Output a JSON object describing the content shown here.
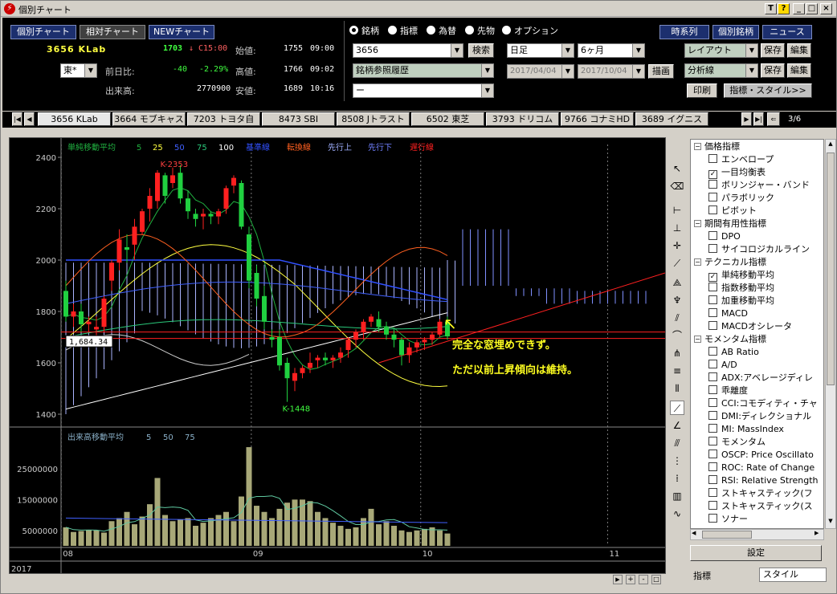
{
  "window": {
    "title": "個別チャート",
    "buttons": [
      "T",
      "?",
      "_",
      "□",
      "×"
    ]
  },
  "toolbar": {
    "view_buttons": [
      "個別チャート",
      "相対チャート",
      "NEWチャート"
    ],
    "right_buttons": [
      "時系列",
      "個別銘柄",
      "ニュース"
    ],
    "market_radios": [
      "銘柄",
      "指標",
      "為替",
      "先物",
      "オプション"
    ],
    "selected_radio": "銘柄"
  },
  "quote": {
    "code_name": "3656 KLab",
    "price": "1703",
    "arrow": "↓",
    "time_tag": "C15:00",
    "market": "東*",
    "change_label": "前日比:",
    "change": "-40",
    "change_pct": "-2.29%",
    "volume_label": "出来高:",
    "volume": "2770900",
    "open_label": "始値:",
    "open": "1755",
    "open_time": "09:00",
    "high_label": "高値:",
    "high": "1766",
    "high_time": "09:02",
    "low_label": "安値:",
    "low": "1689",
    "low_time": "10:16"
  },
  "search": {
    "code_value": "3656",
    "search_button": "検索",
    "history": "銘柄参照履歴",
    "third": "ー"
  },
  "period": {
    "interval": "日足",
    "span": "6ヶ月",
    "from": "2017/04/04",
    "to": "2017/10/04",
    "draw_button": "描画"
  },
  "right_controls": {
    "layout": "レイアウト",
    "analysis": "分析線",
    "save": "保存",
    "edit": "編集",
    "print": "印刷",
    "indicator_style": "指標・スタイル>>"
  },
  "tabs": [
    {
      "label": "3656 KLab",
      "selected": true
    },
    {
      "label": "3664 モブキャス"
    },
    {
      "label": "7203 トヨタ自"
    },
    {
      "label": "8473 SBI"
    },
    {
      "label": "8508 Jトラスト"
    },
    {
      "label": "6502 東芝"
    },
    {
      "label": "3793 ドリコム"
    },
    {
      "label": "9766 コナミHD"
    },
    {
      "label": "3689 イグニス"
    }
  ],
  "tab_page": "3/6",
  "legend": {
    "sma_label": "単純移動平均",
    "sma_periods": [
      "5",
      "25",
      "50",
      "75",
      "100"
    ],
    "ichimoku": [
      "基準線",
      "転換線",
      "先行上",
      "先行下",
      "遅行線"
    ],
    "volume_label": "出来高移動平均",
    "volume_periods": [
      "5",
      "50",
      "75"
    ]
  },
  "annotations": {
    "high_marker": "K-2353",
    "low_marker": "K-1448",
    "price_box": "1,684.34",
    "comment1": "完全な窓埋めできず。",
    "comment2": "ただ以前上昇傾向は維持。"
  },
  "colors": {
    "up": "#ff2020",
    "down": "#20d040",
    "sma5": "#20b040",
    "sma25": "#ffff40",
    "sma50": "#4060ff",
    "sma75": "#2ac87a",
    "sma100": "#ffffff",
    "kijun": "#3050ff",
    "tenkan": "#ff6020",
    "span_a": "#a0b0ff",
    "span_b": "#7080ff",
    "chikou": "#ff2020",
    "comment": "#ffff20"
  },
  "chart_data": {
    "type": "candlestick",
    "ylim": [
      1350,
      2450
    ],
    "yticks": [
      1400,
      1600,
      1800,
      2000,
      2200,
      2400
    ],
    "xlabels": [
      "08",
      "09",
      "10",
      "11"
    ],
    "year": "2017",
    "candles": [
      [
        1880,
        1920,
        1760,
        1780
      ],
      [
        1780,
        1830,
        1740,
        1800
      ],
      [
        1800,
        1830,
        1720,
        1750
      ],
      [
        1750,
        1780,
        1720,
        1760
      ],
      [
        1730,
        1780,
        1700,
        1740
      ],
      [
        1740,
        1860,
        1720,
        1850
      ],
      [
        1920,
        2000,
        1880,
        1990
      ],
      [
        1990,
        2120,
        1960,
        2080
      ],
      [
        2050,
        2100,
        1990,
        2040
      ],
      [
        2060,
        2160,
        2000,
        2130
      ],
      [
        2110,
        2200,
        2100,
        2190
      ],
      [
        2200,
        2280,
        2150,
        2250
      ],
      [
        2230,
        2350,
        2200,
        2340
      ],
      [
        2330,
        2340,
        2220,
        2250
      ],
      [
        2300,
        2360,
        2280,
        2330
      ],
      [
        2340,
        2370,
        2220,
        2240
      ],
      [
        2240,
        2270,
        2160,
        2190
      ],
      [
        2180,
        2200,
        2130,
        2160
      ],
      [
        2170,
        2200,
        2120,
        2180
      ],
      [
        2180,
        2190,
        2140,
        2170
      ],
      [
        2170,
        2200,
        2140,
        2190
      ],
      [
        2200,
        2290,
        2180,
        2280
      ],
      [
        2290,
        2330,
        2260,
        2320
      ],
      [
        2300,
        2310,
        2120,
        2130
      ],
      [
        2100,
        2130,
        1890,
        1920
      ],
      [
        1950,
        1980,
        1820,
        1850
      ],
      [
        1860,
        1900,
        1730,
        1760
      ],
      [
        1700,
        1730,
        1660,
        1690
      ],
      [
        1700,
        1730,
        1570,
        1590
      ],
      [
        1600,
        1620,
        1448,
        1540
      ],
      [
        1530,
        1580,
        1490,
        1560
      ],
      [
        1560,
        1590,
        1540,
        1580
      ],
      [
        1580,
        1640,
        1560,
        1600
      ],
      [
        1610,
        1630,
        1580,
        1620
      ],
      [
        1620,
        1640,
        1590,
        1610
      ],
      [
        1610,
        1630,
        1580,
        1620
      ],
      [
        1620,
        1660,
        1600,
        1640
      ],
      [
        1650,
        1700,
        1620,
        1690
      ],
      [
        1690,
        1730,
        1660,
        1720
      ],
      [
        1720,
        1770,
        1690,
        1760
      ],
      [
        1760,
        1790,
        1740,
        1780
      ],
      [
        1770,
        1800,
        1720,
        1740
      ],
      [
        1740,
        1760,
        1690,
        1710
      ],
      [
        1710,
        1730,
        1660,
        1690
      ],
      [
        1690,
        1700,
        1590,
        1630
      ],
      [
        1630,
        1680,
        1600,
        1660
      ],
      [
        1660,
        1690,
        1640,
        1680
      ],
      [
        1680,
        1700,
        1650,
        1690
      ],
      [
        1690,
        1720,
        1670,
        1710
      ],
      [
        1710,
        1770,
        1700,
        1760
      ],
      [
        1760,
        1780,
        1690,
        1703
      ]
    ],
    "volume": {
      "ylim": [
        0,
        38000000
      ],
      "yticks": [
        5000000,
        15000000,
        25000000
      ],
      "ytick_labels": [
        "5000000",
        "15000000",
        "25000000"
      ],
      "values": [
        6000000,
        4500000,
        4800000,
        5200000,
        5000000,
        4300000,
        8000000,
        9000000,
        11000000,
        7000000,
        9500000,
        13500000,
        22000000,
        10000000,
        8000000,
        8500000,
        9000000,
        6500000,
        7500000,
        9000000,
        10000000,
        11000000,
        8000000,
        16000000,
        32000000,
        13000000,
        11000000,
        9000000,
        12000000,
        14000000,
        15000000,
        15000000,
        14500000,
        11000000,
        9000000,
        7500000,
        6500000,
        5500000,
        6000000,
        9000000,
        12000000,
        7000000,
        8000000,
        6500000,
        5000000,
        4500000,
        5000000,
        5500000,
        6000000,
        5000000,
        4000000
      ]
    }
  },
  "indicator_tree": [
    {
      "type": "group",
      "label": "価格指標"
    },
    {
      "type": "item",
      "label": "エンベロープ",
      "checked": false
    },
    {
      "type": "item",
      "label": "一目均衡表",
      "checked": true
    },
    {
      "type": "item",
      "label": "ボリンジャー・バンド",
      "checked": false
    },
    {
      "type": "item",
      "label": "パラボリック",
      "checked": false
    },
    {
      "type": "item",
      "label": "ピボット",
      "checked": false
    },
    {
      "type": "group",
      "label": "期間有用性指標"
    },
    {
      "type": "item",
      "label": "DPO",
      "checked": false
    },
    {
      "type": "item",
      "label": "サイコロジカルライン",
      "checked": false
    },
    {
      "type": "group",
      "label": "テクニカル指標"
    },
    {
      "type": "item",
      "label": "単純移動平均",
      "checked": true
    },
    {
      "type": "item",
      "label": "指数移動平均",
      "checked": false
    },
    {
      "type": "item",
      "label": "加重移動平均",
      "checked": false
    },
    {
      "type": "item",
      "label": "MACD",
      "checked": false
    },
    {
      "type": "item",
      "label": "MACDオシレータ",
      "checked": false
    },
    {
      "type": "group",
      "label": "モメンタム指標"
    },
    {
      "type": "item",
      "label": "AB Ratio",
      "checked": false
    },
    {
      "type": "item",
      "label": "A/D",
      "checked": false
    },
    {
      "type": "item",
      "label": "ADX:アベレージディレ",
      "checked": false
    },
    {
      "type": "item",
      "label": "乖離度",
      "checked": false
    },
    {
      "type": "item",
      "label": "CCI:コモディティ・チャ",
      "checked": false
    },
    {
      "type": "item",
      "label": "DMI:ディレクショナル",
      "checked": false
    },
    {
      "type": "item",
      "label": "MI: MassIndex",
      "checked": false
    },
    {
      "type": "item",
      "label": "モメンタム",
      "checked": false
    },
    {
      "type": "item",
      "label": "OSCP: Price Oscillato",
      "checked": false
    },
    {
      "type": "item",
      "label": "ROC: Rate of Change",
      "checked": false
    },
    {
      "type": "item",
      "label": "RSI: Relative Strength",
      "checked": false
    },
    {
      "type": "item",
      "label": "ストキャスティック(フ",
      "checked": false
    },
    {
      "type": "item",
      "label": "ストキャスティック(ス",
      "checked": false
    },
    {
      "type": "item",
      "label": "ソナー",
      "checked": false
    }
  ],
  "panel": {
    "settings_button": "設定",
    "tab_indicator": "指標",
    "tab_style": "スタイル"
  }
}
